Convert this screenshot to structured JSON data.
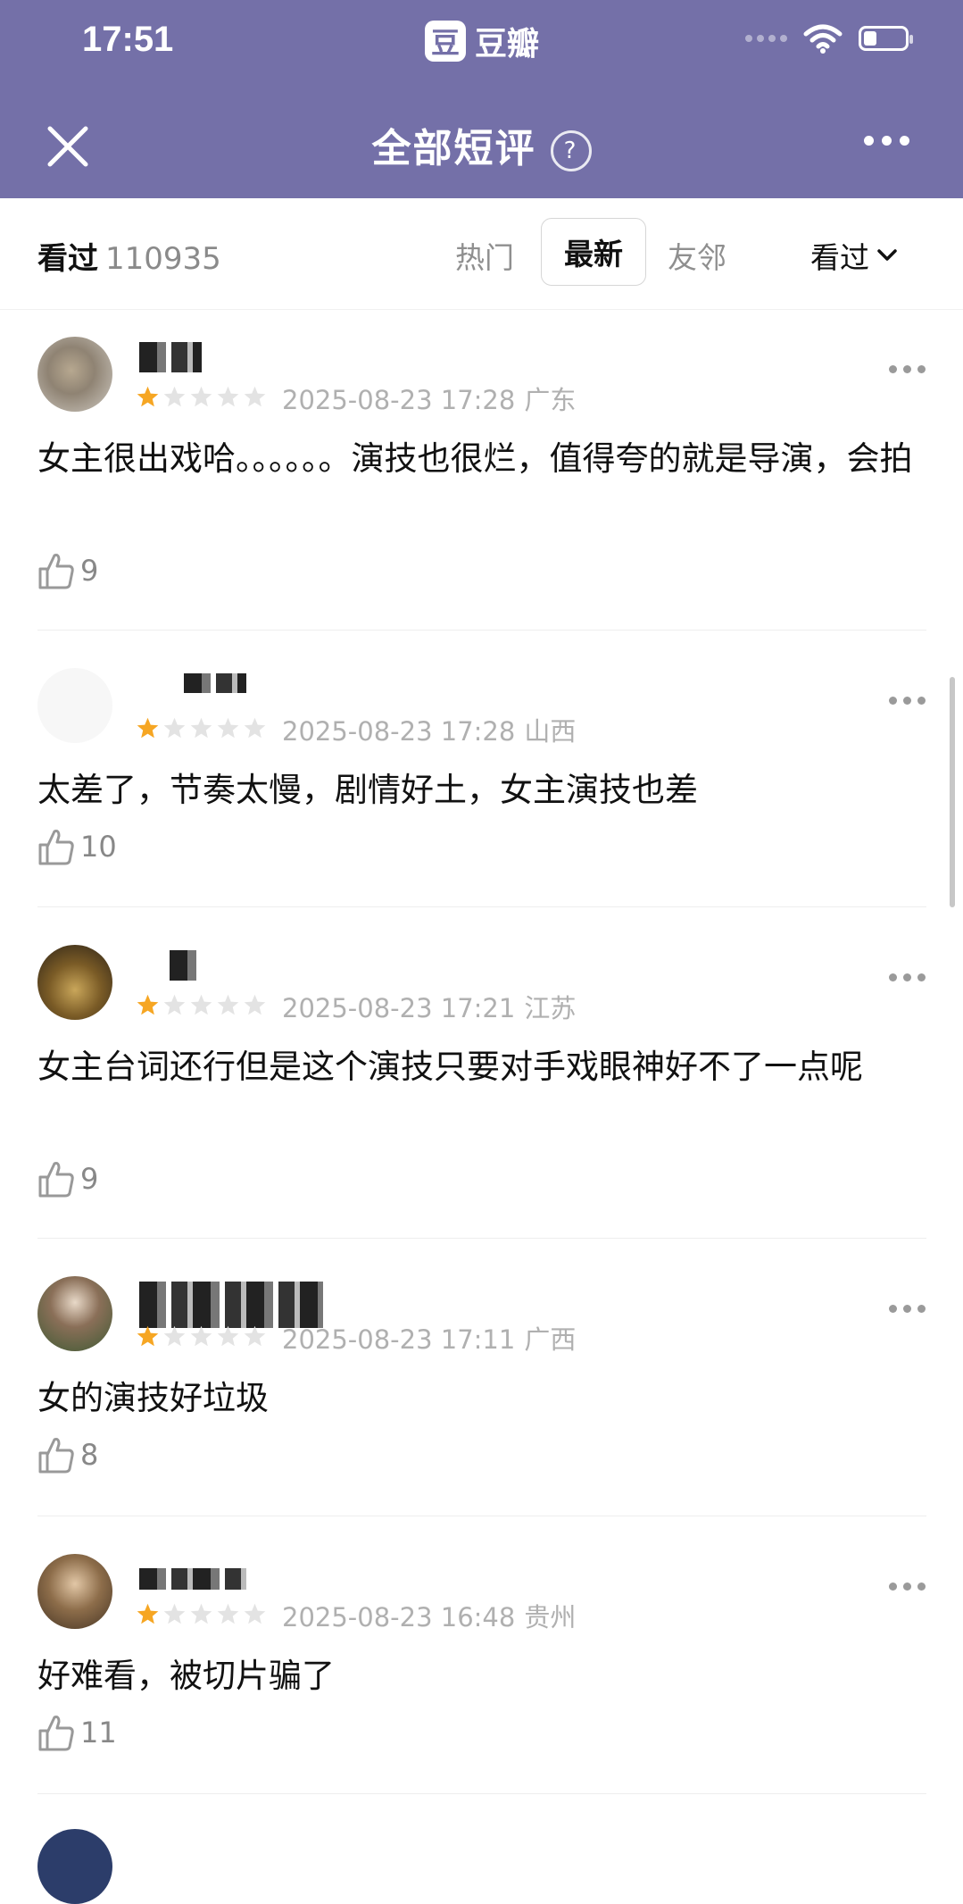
{
  "status_bar": {
    "time": "17:51",
    "app_logo": "豆",
    "app_name": "豆瓣"
  },
  "nav": {
    "title": "全部短评",
    "help_icon": "?"
  },
  "filter": {
    "seen_label": "看过",
    "seen_count": "110935",
    "tabs": [
      "热门",
      "最新",
      "友邻"
    ],
    "active_tab": "最新",
    "status_select": "看过"
  },
  "colors": {
    "header_bg": "#7470a8",
    "star_active": "#f6a623",
    "star_inactive": "#e3e3e3"
  },
  "reviews": [
    {
      "date": "2025-08-23 17:28",
      "location": "广东",
      "rating": 1,
      "content": "女主很出戏哈。。。。。。演技也很烂，值得夸的就是导演，会拍",
      "likes": "9"
    },
    {
      "date": "2025-08-23 17:28",
      "location": "山西",
      "rating": 1,
      "content": "太差了，节奏太慢，剧情好土，女主演技也差",
      "likes": "10"
    },
    {
      "date": "2025-08-23 17:21",
      "location": "江苏",
      "rating": 1,
      "content": "女主台词还行但是这个演技只要对手戏眼神好不了一点呢",
      "likes": "9"
    },
    {
      "date": "2025-08-23 17:11",
      "location": "广西",
      "rating": 1,
      "content": "女的演技好垃圾",
      "likes": "8"
    },
    {
      "date": "2025-08-23 16:48",
      "location": "贵州",
      "rating": 1,
      "content": "好难看，被切片骗了",
      "likes": "11"
    }
  ]
}
